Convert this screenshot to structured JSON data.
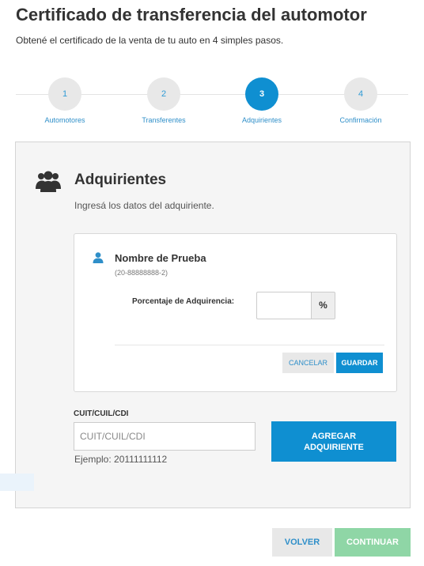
{
  "header": {
    "title": "Certificado de transferencia del automotor",
    "subtitle": "Obtené el certificado de la venta de tu auto en 4 simples pasos."
  },
  "stepper": {
    "steps": [
      {
        "number": "1",
        "label": "Automotores",
        "active": false
      },
      {
        "number": "2",
        "label": "Transferentes",
        "active": false
      },
      {
        "number": "3",
        "label": "Adquirientes",
        "active": true
      },
      {
        "number": "4",
        "label": "Confirmación",
        "active": false
      }
    ]
  },
  "panel": {
    "icon": "users-group-icon",
    "heading": "Adquirientes",
    "description": "Ingresá los datos del adquiriente."
  },
  "person_card": {
    "icon": "user-icon",
    "name": "Nombre de Prueba",
    "id": "(20-88888888-2)",
    "percent_label": "Porcentaje de Adquirencia:",
    "percent_value": "",
    "percent_addon": "%",
    "cancel_label": "CANCELAR",
    "save_label": "GUARDAR"
  },
  "cuit": {
    "label": "CUIT/CUIL/CDI",
    "placeholder": "CUIT/CUIL/CDI",
    "value": "",
    "example": "Ejemplo: 20111111112",
    "add_label": "AGREGAR ADQUIRIENTE"
  },
  "footer": {
    "back_label": "VOLVER",
    "continue_label": "CONTINUAR"
  },
  "colors": {
    "primary": "#0f8fd1",
    "link": "#2f8fc9",
    "continue_disabled": "#8fd6a6",
    "step_inactive": "#e8e8e8"
  }
}
